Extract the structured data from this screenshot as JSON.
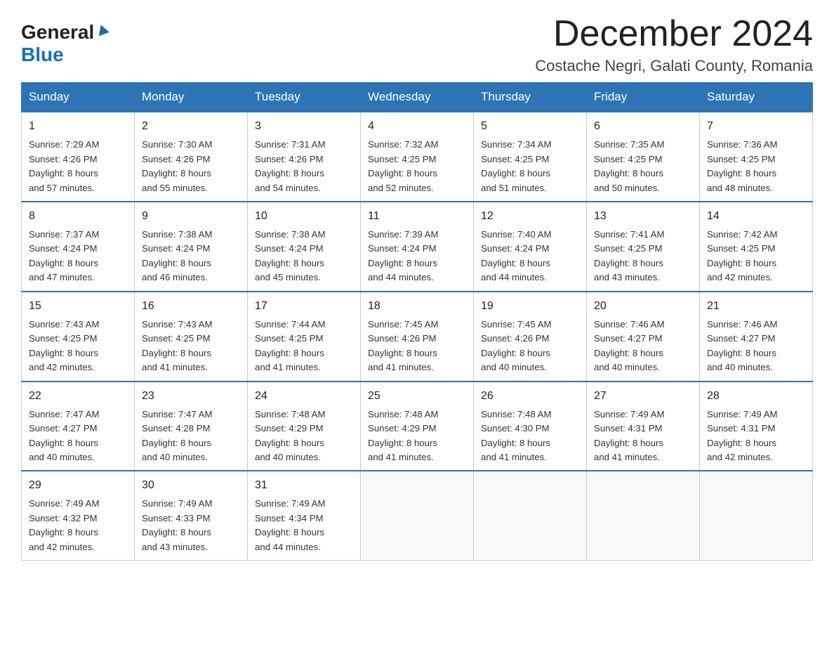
{
  "logo": {
    "general": "General",
    "blue": "Blue"
  },
  "header": {
    "month": "December 2024",
    "location": "Costache Negri, Galati County, Romania"
  },
  "weekdays": [
    "Sunday",
    "Monday",
    "Tuesday",
    "Wednesday",
    "Thursday",
    "Friday",
    "Saturday"
  ],
  "weeks": [
    [
      {
        "day": "1",
        "sunrise": "7:29 AM",
        "sunset": "4:26 PM",
        "daylight": "8 hours and 57 minutes."
      },
      {
        "day": "2",
        "sunrise": "7:30 AM",
        "sunset": "4:26 PM",
        "daylight": "8 hours and 55 minutes."
      },
      {
        "day": "3",
        "sunrise": "7:31 AM",
        "sunset": "4:26 PM",
        "daylight": "8 hours and 54 minutes."
      },
      {
        "day": "4",
        "sunrise": "7:32 AM",
        "sunset": "4:25 PM",
        "daylight": "8 hours and 52 minutes."
      },
      {
        "day": "5",
        "sunrise": "7:34 AM",
        "sunset": "4:25 PM",
        "daylight": "8 hours and 51 minutes."
      },
      {
        "day": "6",
        "sunrise": "7:35 AM",
        "sunset": "4:25 PM",
        "daylight": "8 hours and 50 minutes."
      },
      {
        "day": "7",
        "sunrise": "7:36 AM",
        "sunset": "4:25 PM",
        "daylight": "8 hours and 48 minutes."
      }
    ],
    [
      {
        "day": "8",
        "sunrise": "7:37 AM",
        "sunset": "4:24 PM",
        "daylight": "8 hours and 47 minutes."
      },
      {
        "day": "9",
        "sunrise": "7:38 AM",
        "sunset": "4:24 PM",
        "daylight": "8 hours and 46 minutes."
      },
      {
        "day": "10",
        "sunrise": "7:38 AM",
        "sunset": "4:24 PM",
        "daylight": "8 hours and 45 minutes."
      },
      {
        "day": "11",
        "sunrise": "7:39 AM",
        "sunset": "4:24 PM",
        "daylight": "8 hours and 44 minutes."
      },
      {
        "day": "12",
        "sunrise": "7:40 AM",
        "sunset": "4:24 PM",
        "daylight": "8 hours and 44 minutes."
      },
      {
        "day": "13",
        "sunrise": "7:41 AM",
        "sunset": "4:25 PM",
        "daylight": "8 hours and 43 minutes."
      },
      {
        "day": "14",
        "sunrise": "7:42 AM",
        "sunset": "4:25 PM",
        "daylight": "8 hours and 42 minutes."
      }
    ],
    [
      {
        "day": "15",
        "sunrise": "7:43 AM",
        "sunset": "4:25 PM",
        "daylight": "8 hours and 42 minutes."
      },
      {
        "day": "16",
        "sunrise": "7:43 AM",
        "sunset": "4:25 PM",
        "daylight": "8 hours and 41 minutes."
      },
      {
        "day": "17",
        "sunrise": "7:44 AM",
        "sunset": "4:25 PM",
        "daylight": "8 hours and 41 minutes."
      },
      {
        "day": "18",
        "sunrise": "7:45 AM",
        "sunset": "4:26 PM",
        "daylight": "8 hours and 41 minutes."
      },
      {
        "day": "19",
        "sunrise": "7:45 AM",
        "sunset": "4:26 PM",
        "daylight": "8 hours and 40 minutes."
      },
      {
        "day": "20",
        "sunrise": "7:46 AM",
        "sunset": "4:27 PM",
        "daylight": "8 hours and 40 minutes."
      },
      {
        "day": "21",
        "sunrise": "7:46 AM",
        "sunset": "4:27 PM",
        "daylight": "8 hours and 40 minutes."
      }
    ],
    [
      {
        "day": "22",
        "sunrise": "7:47 AM",
        "sunset": "4:27 PM",
        "daylight": "8 hours and 40 minutes."
      },
      {
        "day": "23",
        "sunrise": "7:47 AM",
        "sunset": "4:28 PM",
        "daylight": "8 hours and 40 minutes."
      },
      {
        "day": "24",
        "sunrise": "7:48 AM",
        "sunset": "4:29 PM",
        "daylight": "8 hours and 40 minutes."
      },
      {
        "day": "25",
        "sunrise": "7:48 AM",
        "sunset": "4:29 PM",
        "daylight": "8 hours and 41 minutes."
      },
      {
        "day": "26",
        "sunrise": "7:48 AM",
        "sunset": "4:30 PM",
        "daylight": "8 hours and 41 minutes."
      },
      {
        "day": "27",
        "sunrise": "7:49 AM",
        "sunset": "4:31 PM",
        "daylight": "8 hours and 41 minutes."
      },
      {
        "day": "28",
        "sunrise": "7:49 AM",
        "sunset": "4:31 PM",
        "daylight": "8 hours and 42 minutes."
      }
    ],
    [
      {
        "day": "29",
        "sunrise": "7:49 AM",
        "sunset": "4:32 PM",
        "daylight": "8 hours and 42 minutes."
      },
      {
        "day": "30",
        "sunrise": "7:49 AM",
        "sunset": "4:33 PM",
        "daylight": "8 hours and 43 minutes."
      },
      {
        "day": "31",
        "sunrise": "7:49 AM",
        "sunset": "4:34 PM",
        "daylight": "8 hours and 44 minutes."
      },
      null,
      null,
      null,
      null
    ]
  ],
  "labels": {
    "sunrise": "Sunrise:",
    "sunset": "Sunset:",
    "daylight": "Daylight:"
  }
}
